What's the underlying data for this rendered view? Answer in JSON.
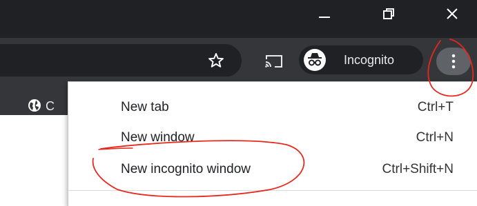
{
  "window_controls": {
    "minimize_icon": "minimize-icon",
    "restore_icon": "restore-icon",
    "close_icon": "close-icon"
  },
  "toolbar": {
    "profile_label": "Incognito",
    "icons": [
      "star-icon",
      "cast-icon",
      "incognito-icon",
      "more-vertical-icon"
    ]
  },
  "bookmarks": {
    "first_item_text": "C",
    "first_item_icon": "globe-icon"
  },
  "menu": {
    "items": [
      {
        "label": "New tab",
        "shortcut": "Ctrl+T"
      },
      {
        "label": "New window",
        "shortcut": "Ctrl+N"
      },
      {
        "label": "New incognito window",
        "shortcut": "Ctrl+Shift+N"
      }
    ]
  },
  "colors": {
    "titlebar_bg": "#202124",
    "toolbar_bg": "#35363a",
    "annotation": "#e8271d"
  }
}
